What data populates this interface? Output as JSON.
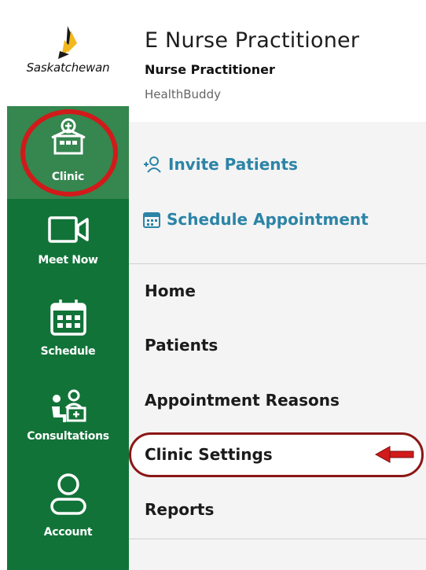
{
  "sidebar": {
    "logo_text": "Saskatchewan",
    "items": [
      {
        "label": "Clinic",
        "icon": "clinic-icon",
        "active": true
      },
      {
        "label": "Meet Now",
        "icon": "video-camera-icon"
      },
      {
        "label": "Schedule",
        "icon": "calendar-icon"
      },
      {
        "label": "Consultations",
        "icon": "consultation-icon"
      },
      {
        "label": "Account",
        "icon": "user-icon"
      }
    ]
  },
  "header": {
    "title": "E Nurse Practitioner",
    "subtitle": "Nurse Practitioner",
    "organization": "HealthBuddy"
  },
  "actions": [
    {
      "label": "Invite Patients",
      "icon": "add-user-icon"
    },
    {
      "label": "Schedule Appointment",
      "icon": "calendar-icon"
    }
  ],
  "menu": [
    {
      "label": "Home"
    },
    {
      "label": "Patients"
    },
    {
      "label": "Appointment Reasons"
    },
    {
      "label": "Clinic Settings",
      "highlighted": true
    },
    {
      "label": "Reports"
    }
  ],
  "colors": {
    "sidebar_bg": "#127339",
    "active_item_bg": "#35864f",
    "action_link": "#2c84a7",
    "highlight_red": "#d11a1a"
  }
}
